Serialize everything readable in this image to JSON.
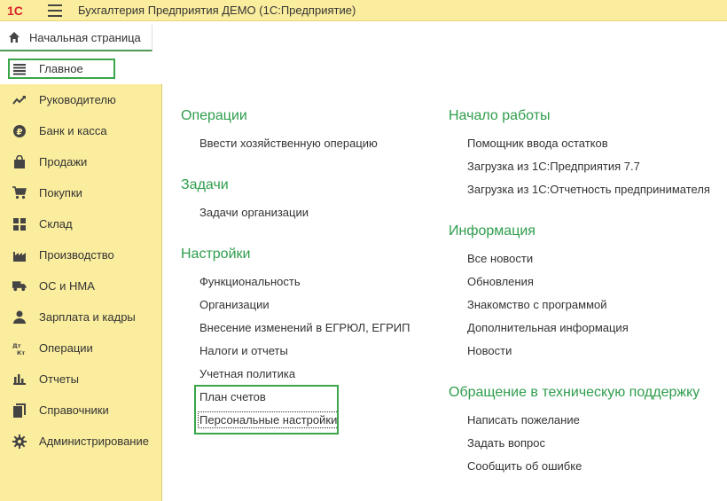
{
  "window": {
    "logo_text": "1С",
    "title": "Бухгалтерия Предприятия ДЕМО  (1С:Предприятие)"
  },
  "start_tab": {
    "label": "Начальная страница"
  },
  "sidebar": {
    "items": [
      {
        "id": "main",
        "label": "Главное",
        "icon": "list-icon"
      },
      {
        "id": "manager",
        "label": "Руководителю",
        "icon": "trend-icon"
      },
      {
        "id": "bank",
        "label": "Банк и касса",
        "icon": "ruble-icon"
      },
      {
        "id": "sales",
        "label": "Продажи",
        "icon": "bag-icon"
      },
      {
        "id": "purchases",
        "label": "Покупки",
        "icon": "cart-icon"
      },
      {
        "id": "warehouse",
        "label": "Склад",
        "icon": "grid-icon"
      },
      {
        "id": "production",
        "label": "Производство",
        "icon": "factory-icon"
      },
      {
        "id": "assets",
        "label": "ОС и НМА",
        "icon": "truck-icon"
      },
      {
        "id": "salary",
        "label": "Зарплата и кадры",
        "icon": "person-icon"
      },
      {
        "id": "operations",
        "label": "Операции",
        "icon": "dt-kt-icon"
      },
      {
        "id": "reports",
        "label": "Отчеты",
        "icon": "bar-chart-icon"
      },
      {
        "id": "references",
        "label": "Справочники",
        "icon": "book-icon"
      },
      {
        "id": "admin",
        "label": "Администрирование",
        "icon": "gear-icon"
      }
    ]
  },
  "left_sections": [
    {
      "title": "Операции",
      "links": [
        "Ввести хозяйственную операцию"
      ]
    },
    {
      "title": "Задачи",
      "links": [
        "Задачи организации"
      ]
    },
    {
      "title": "Настройки",
      "links": [
        "Функциональность",
        "Организации",
        "Внесение изменений в ЕГРЮЛ, ЕГРИП",
        "Налоги и отчеты",
        "Учетная политика",
        "План счетов",
        "Персональные настройки"
      ]
    }
  ],
  "right_sections": [
    {
      "title": "Начало работы",
      "links": [
        "Помощник ввода остатков",
        "Загрузка из 1С:Предприятия 7.7",
        "Загрузка из 1С:Отчетность предпринимателя"
      ]
    },
    {
      "title": "Информация",
      "links": [
        "Все новости",
        "Обновления",
        "Знакомство с программой",
        "Дополнительная информация",
        "Новости"
      ]
    },
    {
      "title": "Обращение в техническую поддержку",
      "links": [
        "Написать пожелание",
        "Задать вопрос",
        "Сообщить об ошибке"
      ]
    }
  ],
  "colors": {
    "sidebar_bg": "#fbed9e",
    "section_heading": "#2f9d4c",
    "highlight_box": "#3aa549",
    "logo_red": "#d9232d"
  }
}
